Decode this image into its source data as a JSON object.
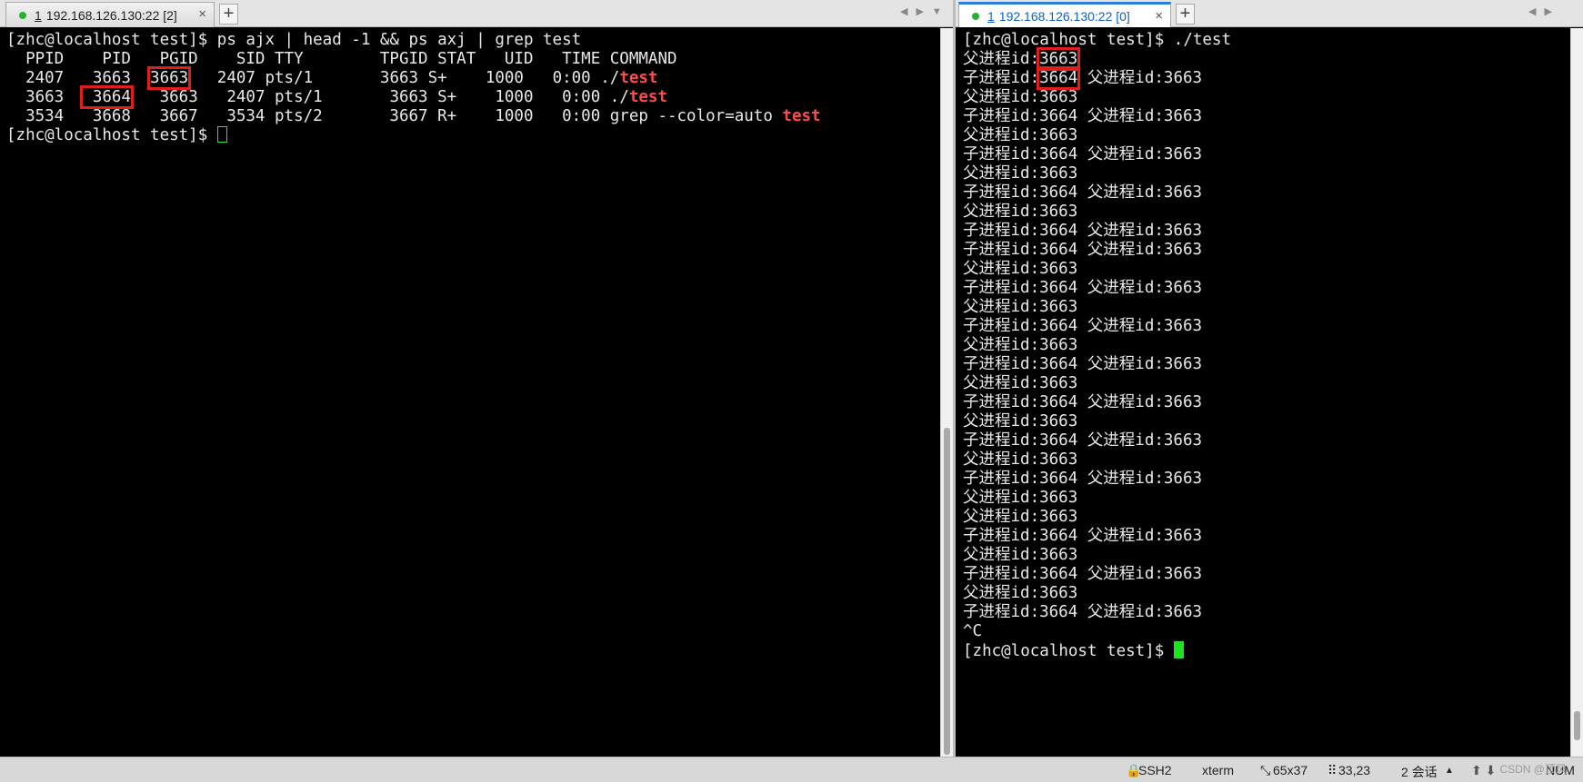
{
  "left_pane": {
    "tab": {
      "number": "1",
      "title": "192.168.126.130:22 [2]",
      "close": "×"
    },
    "add_tab": "+",
    "lines": [
      [
        {
          "t": "[zhc@localhost test]$ ps ajx | head -1 && ps axj | grep test"
        }
      ],
      [
        {
          "t": "  PPID    PID   PGID    SID TTY        TPGID STAT   UID   TIME COMMAND"
        }
      ],
      [
        {
          "t": "  2407   3663  "
        },
        {
          "t": "3663",
          "hl": true
        },
        {
          "t": "   2407 pts/1       3663 S+    1000   0:00 ./"
        },
        {
          "t": "test",
          "red": true
        }
      ],
      [
        {
          "t": "  3663  "
        },
        {
          "t": " 3664",
          "hl": true
        },
        {
          "t": "   3663   2407 pts/1       3663 S+    1000   0:00 ./"
        },
        {
          "t": "test",
          "red": true
        }
      ],
      [
        {
          "t": "  3534   3668   3667   3534 pts/2       3667 R+    1000   0:00 grep --color=auto "
        },
        {
          "t": "test",
          "red": true
        }
      ],
      [
        {
          "t": "[zhc@localhost test]$ "
        },
        {
          "cursor": "hollow"
        }
      ]
    ]
  },
  "right_pane": {
    "tab": {
      "number": "1",
      "title": "192.168.126.130:22 [0]",
      "close": "×"
    },
    "add_tab": "+",
    "lines": [
      [
        {
          "t": "[zhc@localhost test]$ ./test"
        }
      ],
      [
        {
          "t": "父进程id:"
        },
        {
          "t": "3663",
          "hl": true
        }
      ],
      [
        {
          "t": "子进程id:"
        },
        {
          "t": "3664",
          "hl": true
        },
        {
          "t": " 父进程id:3663"
        }
      ],
      [
        {
          "t": "父进程id:3663"
        }
      ],
      [
        {
          "t": "子进程id:3664 父进程id:3663"
        }
      ],
      [
        {
          "t": "父进程id:3663"
        }
      ],
      [
        {
          "t": "子进程id:3664 父进程id:3663"
        }
      ],
      [
        {
          "t": "父进程id:3663"
        }
      ],
      [
        {
          "t": "子进程id:3664 父进程id:3663"
        }
      ],
      [
        {
          "t": "父进程id:3663"
        }
      ],
      [
        {
          "t": "子进程id:3664 父进程id:3663"
        }
      ],
      [
        {
          "t": "子进程id:3664 父进程id:3663"
        }
      ],
      [
        {
          "t": "父进程id:3663"
        }
      ],
      [
        {
          "t": "子进程id:3664 父进程id:3663"
        }
      ],
      [
        {
          "t": "父进程id:3663"
        }
      ],
      [
        {
          "t": "子进程id:3664 父进程id:3663"
        }
      ],
      [
        {
          "t": "父进程id:3663"
        }
      ],
      [
        {
          "t": "子进程id:3664 父进程id:3663"
        }
      ],
      [
        {
          "t": "父进程id:3663"
        }
      ],
      [
        {
          "t": "子进程id:3664 父进程id:3663"
        }
      ],
      [
        {
          "t": "父进程id:3663"
        }
      ],
      [
        {
          "t": "子进程id:3664 父进程id:3663"
        }
      ],
      [
        {
          "t": "父进程id:3663"
        }
      ],
      [
        {
          "t": "子进程id:3664 父进程id:3663"
        }
      ],
      [
        {
          "t": "父进程id:3663"
        }
      ],
      [
        {
          "t": "父进程id:3663"
        }
      ],
      [
        {
          "t": "子进程id:3664 父进程id:3663"
        }
      ],
      [
        {
          "t": "父进程id:3663"
        }
      ],
      [
        {
          "t": "子进程id:3664 父进程id:3663"
        }
      ],
      [
        {
          "t": "父进程id:3663"
        }
      ],
      [
        {
          "t": "子进程id:3664 父进程id:3663"
        }
      ],
      [
        {
          "t": "^C"
        }
      ],
      [
        {
          "t": "[zhc@localhost test]$ "
        },
        {
          "cursor": "solid"
        }
      ]
    ]
  },
  "statusbar": {
    "protocol": "SSH2",
    "term_type": "xterm",
    "size": "65x37",
    "cursor_pos": "33,23",
    "sessions": "2 会话",
    "sessions_arrow": "▲",
    "nav": "⬆ ⬇",
    "num": "NUM",
    "watermark": "CSDN @顶风"
  },
  "colors": {
    "highlight_box": "#e01e1e",
    "match_text": "#ff4a4a",
    "cursor": "#22e022",
    "active_tab": "#1060c8",
    "status_dot": "#25b32f"
  }
}
